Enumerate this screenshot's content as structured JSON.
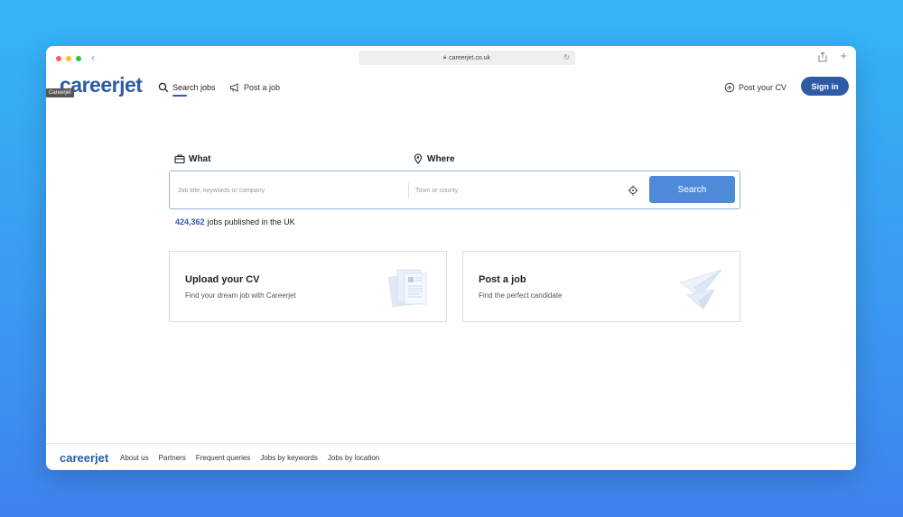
{
  "browser": {
    "url": "careerjet.co.uk"
  },
  "header": {
    "logo": "careerjet",
    "tooltip": "Careerjet",
    "nav_search": "Search jobs",
    "nav_post": "Post a job",
    "post_cv": "Post your CV",
    "sign_in": "Sign in"
  },
  "search": {
    "what_label": "What",
    "where_label": "Where",
    "what_placeholder": "Job title, keywords or company",
    "where_placeholder": "Town or county",
    "button": "Search",
    "count": "424,362",
    "count_suffix": "jobs published in the UK"
  },
  "cards": {
    "cv": {
      "title": "Upload your CV",
      "subtitle": "Find your dream job with Careerjet",
      "icon": "documents-illustration"
    },
    "post": {
      "title": "Post a job",
      "subtitle": "Find the perfect candidate",
      "icon": "paper-plane-illustration"
    }
  },
  "footer": {
    "logo": "careerjet",
    "links": [
      "About us",
      "Partners",
      "Frequent queries",
      "Jobs by keywords",
      "Jobs by location"
    ]
  },
  "colors": {
    "brand": "#2d5ba6",
    "search_button": "#4f8ad9",
    "background_top": "#35b4f7",
    "background_bottom": "#3f83ee"
  }
}
